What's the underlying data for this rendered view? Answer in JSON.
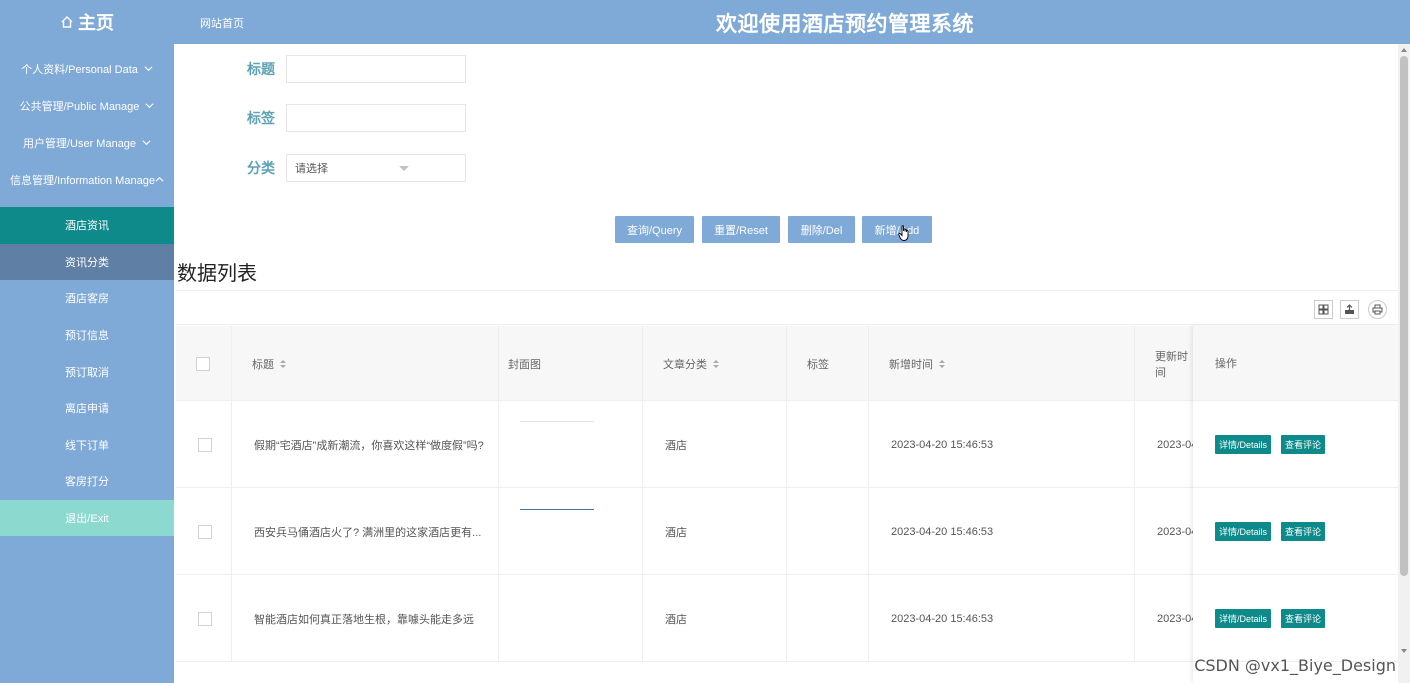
{
  "header": {
    "home_label": "主页",
    "breadcrumb": "网站首页",
    "system_title": "欢迎使用酒店预约管理系统",
    "color": "#7fa9d6"
  },
  "sidebar": {
    "groups": [
      {
        "label": "个人资料/Personal Data",
        "icon": "chevron-down-icon"
      },
      {
        "label": "公共管理/Public Manage",
        "icon": "chevron-down-icon"
      },
      {
        "label": "用户管理/User Manage",
        "icon": "chevron-down-icon"
      },
      {
        "label": "信息管理/Information Manage",
        "icon": "chevron-up-icon"
      }
    ],
    "items": [
      {
        "label": "酒店资讯",
        "state": "active"
      },
      {
        "label": "资讯分类",
        "state": "hover"
      },
      {
        "label": "酒店客房",
        "state": ""
      },
      {
        "label": "预订信息",
        "state": ""
      },
      {
        "label": "预订取消",
        "state": ""
      },
      {
        "label": "离店申请",
        "state": ""
      },
      {
        "label": "线下订单",
        "state": ""
      },
      {
        "label": "客房打分",
        "state": ""
      }
    ],
    "exit_label": "退出/Exit"
  },
  "search": {
    "title_label": "标题",
    "title_value": "",
    "tag_label": "标签",
    "tag_value": "",
    "category_label": "分类",
    "category_placeholder": "请选择"
  },
  "actions": {
    "query": "查询/Query",
    "reset": "重置/Reset",
    "delete": "删除/Del",
    "add": "新增/Add"
  },
  "list": {
    "title": "数据列表",
    "toolbar_icons": [
      "columns-icon",
      "export-icon",
      "print-icon"
    ],
    "columns": [
      "标题",
      "封面图",
      "文章分类",
      "标签",
      "新增时间",
      "更新时间",
      "操作"
    ],
    "rows": [
      {
        "title": "假期“宅酒店”成新潮流，你喜欢这样“做度假”吗?",
        "category": "酒店",
        "tag": "",
        "created": "2023-04-20 15:46:53",
        "updated": "2023-04"
      },
      {
        "title": "西安兵马俑酒店火了? 满洲里的这家酒店更有...",
        "category": "酒店",
        "tag": "",
        "created": "2023-04-20 15:46:53",
        "updated": "2023-04"
      },
      {
        "title": "智能酒店如何真正落地生根，靠噱头能走多远",
        "category": "酒店",
        "tag": "",
        "created": "2023-04-20 15:46:53",
        "updated": "2023-04"
      }
    ],
    "row_actions": {
      "details": "详情/Details",
      "comments": "查看评论"
    }
  },
  "watermark": "CSDN @vx1_Biye_Design",
  "colors": {
    "accent": "#7fa9d6",
    "teal": "#0e8a8a",
    "exit": "#8cd9d0",
    "label": "#5ea3b5"
  }
}
